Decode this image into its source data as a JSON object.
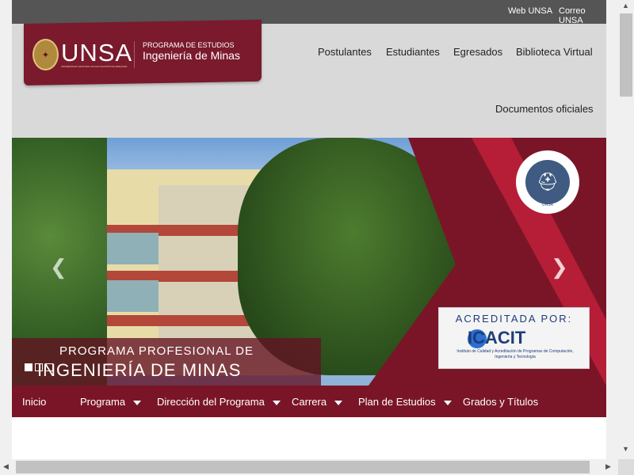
{
  "topbar": {
    "web_link": "Web UNSA",
    "mail_link": "Correo UNSA"
  },
  "brand": {
    "acronym": "UNSA",
    "university_full": "UNIVERSIDAD NACIONAL DE SAN AGUSTÍN DE AREQUIPA",
    "program_label": "PROGRAMA DE ESTUDIOS",
    "program_name": "Ingeniería de Minas",
    "brand_color": "#7a1a2c"
  },
  "main_nav": {
    "items": [
      "Postulantes",
      "Estudiantes",
      "Egresados",
      "Biblioteca Virtual",
      "Documentos oficiales"
    ]
  },
  "hero": {
    "banner_line1": "PROGRAMA PROFESIONAL DE",
    "banner_line2": "INGENIERÍA DE MINAS",
    "accreditation_title": "ACREDITADA POR:",
    "accreditation_org": "ICACIT",
    "accreditation_desc": "Instituto de Calidad y Acreditación de Programas de Computación, Ingeniería y Tecnología",
    "emblem_label": "UNSA",
    "slide_count": 3,
    "active_slide": 1,
    "prev_icon": "chevron-left-icon",
    "next_icon": "chevron-right-icon"
  },
  "bottom_nav": {
    "items": [
      {
        "label": "Inicio",
        "dropdown": false
      },
      {
        "label": "Programa",
        "dropdown": true
      },
      {
        "label": "Dirección del Programa",
        "dropdown": true
      },
      {
        "label": "Carrera",
        "dropdown": true
      },
      {
        "label": "Plan de Estudios",
        "dropdown": true
      },
      {
        "label": "Grados y Títulos",
        "dropdown": false
      }
    ],
    "color": "#7a1527"
  }
}
